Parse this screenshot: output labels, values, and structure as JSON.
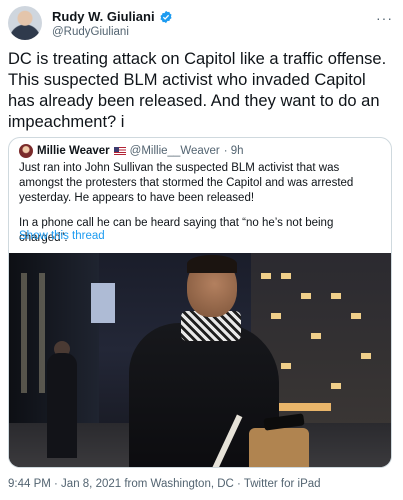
{
  "author": {
    "display_name": "Rudy W. Giuliani",
    "handle": "@RudyGiuliani",
    "verified_icon": "verified-badge-icon"
  },
  "more_label": "···",
  "tweet": {
    "text": "DC is treating attack on Capitol like a traffic offense. This suspected BLM activist who invaded Capitol has already been released. And they want to do an impeachment? i"
  },
  "quoted": {
    "display_name": "Millie Weaver",
    "handle": "@Millie__Weaver",
    "time": "· 9h",
    "paragraph1": "Just ran into John Sullivan the suspected BLM activist that was amongst the protesters that stormed the Capitol and was arrested yesterday. He appears to have been released!",
    "paragraph2": "In a phone call he can be heard saying that “no he’s not being charged”.",
    "show_thread": "Show this thread"
  },
  "footer": {
    "meta": "9:44 PM · Jan 8, 2021 from Washington, DC · Twitter for iPad"
  },
  "colors": {
    "link": "#1d9bf0",
    "secondary_text": "#536471",
    "border": "#cfd9de",
    "verified": "#1d9bf0"
  }
}
